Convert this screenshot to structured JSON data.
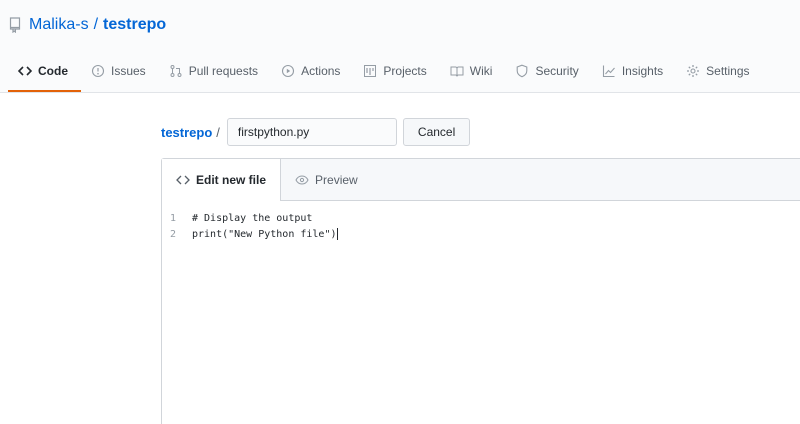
{
  "repo": {
    "owner": "Malika-s",
    "separator": "/",
    "name": "testrepo"
  },
  "tabs": [
    {
      "label": "Code",
      "icon": "code-icon",
      "selected": true
    },
    {
      "label": "Issues",
      "icon": "issue-icon"
    },
    {
      "label": "Pull requests",
      "icon": "pull-request-icon"
    },
    {
      "label": "Actions",
      "icon": "play-icon"
    },
    {
      "label": "Projects",
      "icon": "project-icon"
    },
    {
      "label": "Wiki",
      "icon": "book-icon"
    },
    {
      "label": "Security",
      "icon": "shield-icon"
    },
    {
      "label": "Insights",
      "icon": "graph-icon"
    },
    {
      "label": "Settings",
      "icon": "gear-icon"
    }
  ],
  "editor": {
    "breadcrumb": "testrepo",
    "breadcrumb_sep": "/",
    "filename": "firstpython.py",
    "cancel_label": "Cancel",
    "file_tabs": {
      "edit": "Edit new file",
      "preview": "Preview"
    },
    "lines": [
      {
        "num": "1",
        "text": "# Display the output"
      },
      {
        "num": "2",
        "text": "print(\"New Python file\")"
      }
    ]
  },
  "colors": {
    "accent": "#e36209",
    "link": "#0366d6"
  }
}
